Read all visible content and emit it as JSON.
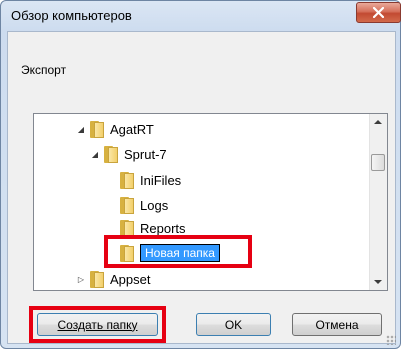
{
  "window": {
    "title": "Обзор компьютеров"
  },
  "caption": "Экспорт",
  "tree": {
    "nodes": [
      {
        "label": "AgatRT",
        "expander": "◢"
      },
      {
        "label": "Sprut-7",
        "expander": "◢"
      },
      {
        "label": "IniFiles",
        "expander": ""
      },
      {
        "label": "Logs",
        "expander": ""
      },
      {
        "label": "Reports",
        "expander": ""
      },
      {
        "label": "Новая папка",
        "expander": ""
      },
      {
        "label": "Appset",
        "expander": "▷"
      }
    ]
  },
  "buttons": {
    "make_folder": "Создать папку",
    "ok": "OK",
    "cancel": "Отмена"
  },
  "icons": {
    "close": "close-icon",
    "folder": "folder-icon"
  },
  "colors": {
    "highlight": "#e60012",
    "selection": "#3399ff"
  }
}
